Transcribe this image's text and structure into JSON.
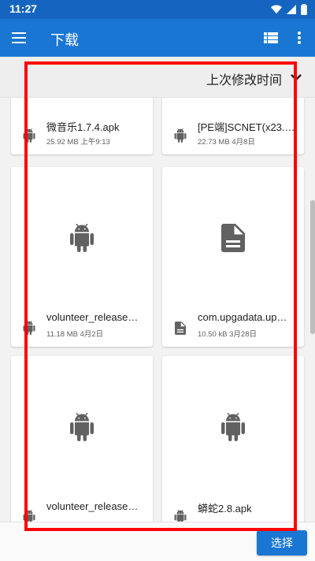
{
  "status_bar": {
    "time": "11:27"
  },
  "app_bar": {
    "title": "下载",
    "menu_icon": "menu-icon",
    "list_view_icon": "list-view-icon",
    "more_icon": "more-vert-icon"
  },
  "sort": {
    "label": "上次修改时间",
    "icon": "chevron-down-icon"
  },
  "files": [
    {
      "name": "微音乐1.7.4.apk",
      "size": "25.92 MB",
      "date": "上午9:13",
      "type": "android"
    },
    {
      "name": "[PE端]SCNET(x23.…",
      "size": "22.73 MB",
      "date": "4月8日",
      "type": "document"
    },
    {
      "name": "volunteer_release…",
      "size": "11.18 MB",
      "date": "4月2日",
      "type": "android"
    },
    {
      "name": "com.upgadata.up…",
      "size": "10.50 kB",
      "date": "3月28日",
      "type": "document"
    },
    {
      "name": "volunteer_release…",
      "size": "",
      "date": "",
      "type": "android"
    },
    {
      "name": "蟒蛇2.8.apk",
      "size": "",
      "date": "",
      "type": "android"
    }
  ],
  "bottom_bar": {
    "select_label": "选择"
  },
  "colors": {
    "app_bar": "#1976d2",
    "status_bar": "#1565c0",
    "highlight": "#ff0000",
    "icon_gray": "#616161"
  }
}
